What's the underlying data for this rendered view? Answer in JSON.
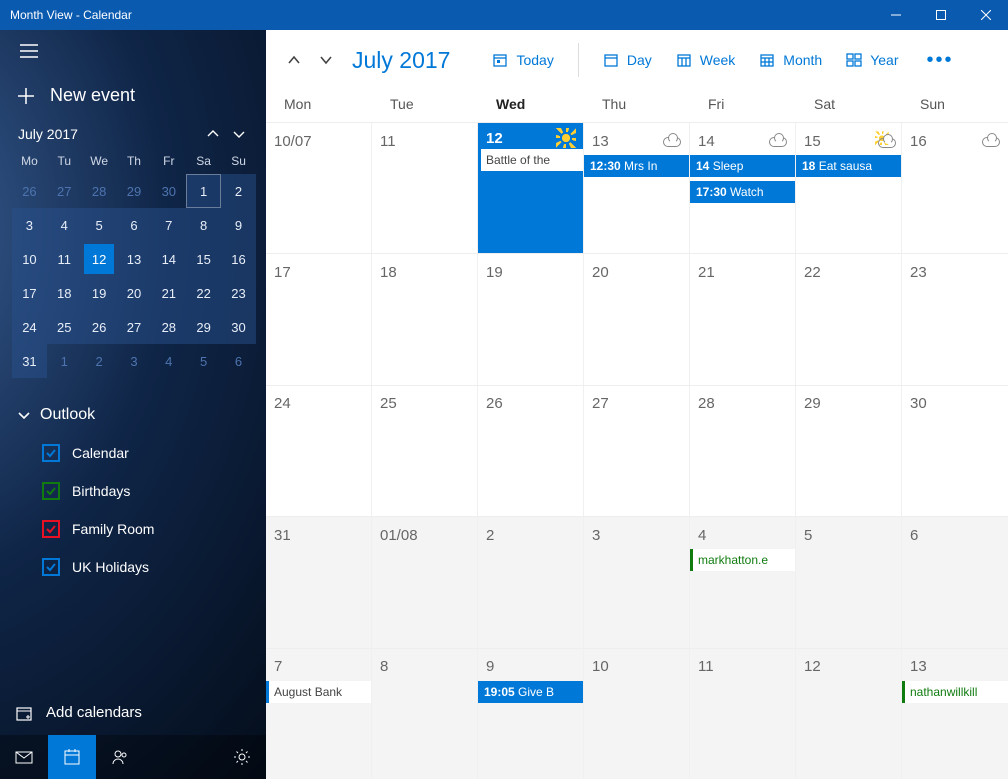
{
  "window": {
    "title": "Month View - Calendar"
  },
  "sidebar": {
    "new_event": "New event",
    "mini_month": "July 2017",
    "days_short": [
      "Mo",
      "Tu",
      "We",
      "Th",
      "Fr",
      "Sa",
      "Su"
    ],
    "mini_rows": [
      [
        {
          "d": "26",
          "dim": true
        },
        {
          "d": "27",
          "dim": true
        },
        {
          "d": "28",
          "dim": true
        },
        {
          "d": "29",
          "dim": true
        },
        {
          "d": "30",
          "dim": true
        },
        {
          "d": "1",
          "hl": true,
          "box": true
        },
        {
          "d": "2",
          "hl": true
        }
      ],
      [
        {
          "d": "3",
          "hl": true
        },
        {
          "d": "4",
          "hl": true
        },
        {
          "d": "5",
          "hl": true
        },
        {
          "d": "6",
          "hl": true
        },
        {
          "d": "7",
          "hl": true
        },
        {
          "d": "8",
          "hl": true
        },
        {
          "d": "9",
          "hl": true
        }
      ],
      [
        {
          "d": "10",
          "hl": true
        },
        {
          "d": "11",
          "hl": true
        },
        {
          "d": "12",
          "hl": true,
          "sel": true
        },
        {
          "d": "13",
          "hl": true
        },
        {
          "d": "14",
          "hl": true
        },
        {
          "d": "15",
          "hl": true
        },
        {
          "d": "16",
          "hl": true
        }
      ],
      [
        {
          "d": "17",
          "hl": true
        },
        {
          "d": "18",
          "hl": true
        },
        {
          "d": "19",
          "hl": true
        },
        {
          "d": "20",
          "hl": true
        },
        {
          "d": "21",
          "hl": true
        },
        {
          "d": "22",
          "hl": true
        },
        {
          "d": "23",
          "hl": true
        }
      ],
      [
        {
          "d": "24",
          "hl": true
        },
        {
          "d": "25",
          "hl": true
        },
        {
          "d": "26",
          "hl": true
        },
        {
          "d": "27",
          "hl": true
        },
        {
          "d": "28",
          "hl": true
        },
        {
          "d": "29",
          "hl": true
        },
        {
          "d": "30",
          "hl": true
        }
      ],
      [
        {
          "d": "31",
          "hl": true
        },
        {
          "d": "1",
          "dim": true
        },
        {
          "d": "2",
          "dim": true
        },
        {
          "d": "3",
          "dim": true
        },
        {
          "d": "4",
          "dim": true
        },
        {
          "d": "5",
          "dim": true
        },
        {
          "d": "6",
          "dim": true
        }
      ]
    ],
    "account": "Outlook",
    "calendars": [
      {
        "label": "Calendar",
        "color": "#0078d7"
      },
      {
        "label": "Birthdays",
        "color": "#107c10"
      },
      {
        "label": "Family Room",
        "color": "#e81123"
      },
      {
        "label": "UK Holidays",
        "color": "#0078d7"
      }
    ],
    "add_calendars": "Add calendars"
  },
  "toolbar": {
    "title": "July 2017",
    "today": "Today",
    "day": "Day",
    "week": "Week",
    "month": "Month",
    "year": "Year"
  },
  "day_headers": [
    "Mon",
    "Tue",
    "Wed",
    "Thu",
    "Fri",
    "Sat",
    "Sun"
  ],
  "today_index": 2,
  "weeks": [
    {
      "next": false,
      "cells": [
        {
          "label": "10/07",
          "weather": null,
          "events": []
        },
        {
          "label": "11",
          "weather": null,
          "events": []
        },
        {
          "label": "12",
          "weather": "sun",
          "today": true,
          "events": [
            {
              "style": "white",
              "text": "Battle of the"
            }
          ]
        },
        {
          "label": "13",
          "weather": "cloud",
          "events": [
            {
              "style": "blue",
              "time": "12:30",
              "text": "Mrs In"
            }
          ]
        },
        {
          "label": "14",
          "weather": "cloud",
          "events": [
            {
              "style": "blue",
              "time": "14",
              "text": "Sleep"
            },
            {
              "style": "blue",
              "time": "17:30",
              "text": "Watch"
            }
          ]
        },
        {
          "label": "15",
          "weather": "partly",
          "events": [
            {
              "style": "blue",
              "time": "18",
              "text": "Eat sausa"
            }
          ]
        },
        {
          "label": "16",
          "weather": "cloud",
          "events": []
        }
      ]
    },
    {
      "next": false,
      "cells": [
        {
          "label": "17"
        },
        {
          "label": "18"
        },
        {
          "label": "19"
        },
        {
          "label": "20"
        },
        {
          "label": "21"
        },
        {
          "label": "22"
        },
        {
          "label": "23"
        }
      ]
    },
    {
      "next": false,
      "cells": [
        {
          "label": "24"
        },
        {
          "label": "25"
        },
        {
          "label": "26"
        },
        {
          "label": "27"
        },
        {
          "label": "28"
        },
        {
          "label": "29"
        },
        {
          "label": "30"
        }
      ]
    },
    {
      "next": true,
      "cells": [
        {
          "label": "31"
        },
        {
          "label": "01/08"
        },
        {
          "label": "2"
        },
        {
          "label": "3"
        },
        {
          "label": "4",
          "events": [
            {
              "style": "green",
              "text": "markhatton.e"
            }
          ]
        },
        {
          "label": "5"
        },
        {
          "label": "6"
        }
      ]
    },
    {
      "next": true,
      "cells": [
        {
          "label": "7",
          "events": [
            {
              "style": "white",
              "text": "August Bank"
            }
          ]
        },
        {
          "label": "8"
        },
        {
          "label": "9",
          "events": [
            {
              "style": "blue",
              "time": "19:05",
              "text": "Give B"
            }
          ]
        },
        {
          "label": "10"
        },
        {
          "label": "11"
        },
        {
          "label": "12"
        },
        {
          "label": "13",
          "events": [
            {
              "style": "green",
              "text": "nathanwillkill"
            }
          ]
        }
      ]
    }
  ]
}
